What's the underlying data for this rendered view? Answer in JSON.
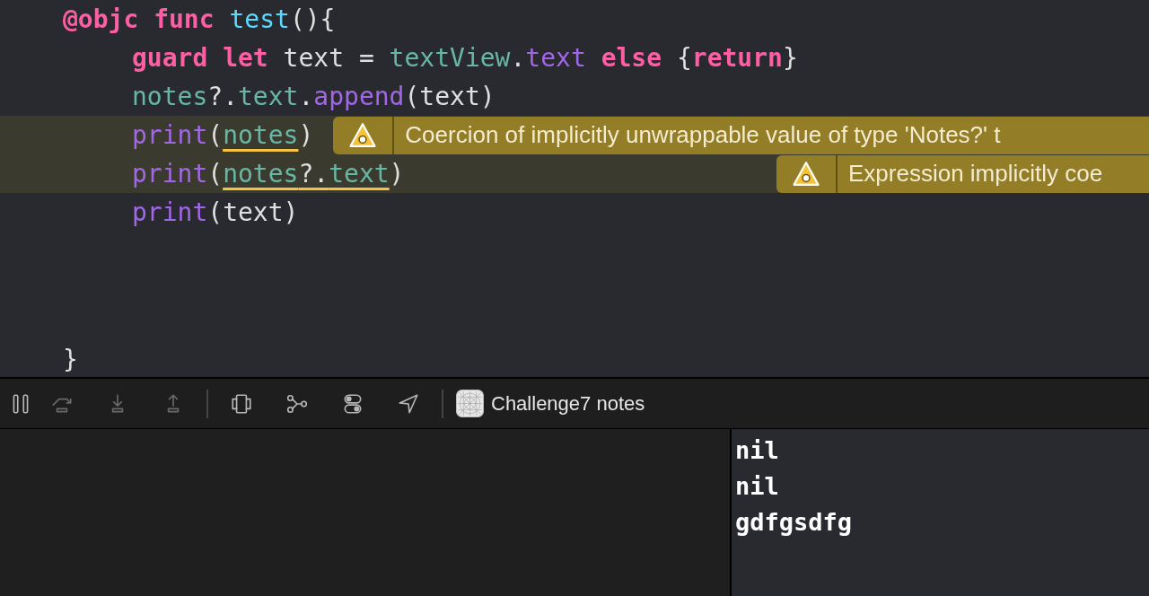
{
  "editor": {
    "lines": [
      {
        "tokens": [
          {
            "text": "@objc ",
            "kind": "keyword"
          },
          {
            "text": "func ",
            "kind": "keyword"
          },
          {
            "text": "test",
            "kind": "decl"
          },
          {
            "text": "(){",
            "kind": "plain"
          }
        ],
        "children": [
          {
            "tokens": [
              {
                "text": "guard ",
                "kind": "keyword"
              },
              {
                "text": "let ",
                "kind": "keyword"
              },
              {
                "text": "text = ",
                "kind": "plain"
              },
              {
                "text": "textView",
                "kind": "property"
              },
              {
                "text": ".",
                "kind": "plain"
              },
              {
                "text": "text ",
                "kind": "method"
              },
              {
                "text": "else ",
                "kind": "keyword"
              },
              {
                "text": "{",
                "kind": "plain"
              },
              {
                "text": "return",
                "kind": "keyword"
              },
              {
                "text": "}",
                "kind": "plain"
              }
            ]
          },
          {
            "tokens": [
              {
                "text": "notes",
                "kind": "property"
              },
              {
                "text": "?.",
                "kind": "plain"
              },
              {
                "text": "text",
                "kind": "property"
              },
              {
                "text": ".",
                "kind": "plain"
              },
              {
                "text": "append",
                "kind": "method"
              },
              {
                "text": "(text)",
                "kind": "plain"
              }
            ]
          },
          {
            "tokens": [
              {
                "text": "print",
                "kind": "method"
              },
              {
                "text": "(",
                "kind": "plain"
              },
              {
                "text": "notes",
                "kind": "property",
                "underlined": true
              },
              {
                "text": ")",
                "kind": "plain"
              }
            ],
            "warning": "Coercion of implicitly unwrappable value of type 'Notes?' t"
          },
          {
            "tokens": [
              {
                "text": "print",
                "kind": "method"
              },
              {
                "text": "(",
                "kind": "plain"
              },
              {
                "text": "notes",
                "kind": "property",
                "underlined": true
              },
              {
                "text": "?.",
                "kind": "plain",
                "underlined": true
              },
              {
                "text": "text",
                "kind": "property",
                "underlined": true
              },
              {
                "text": ")",
                "kind": "plain"
              }
            ],
            "warning": "Expression implicitly coe"
          },
          {
            "tokens": [
              {
                "text": "print",
                "kind": "method"
              },
              {
                "text": "(text)",
                "kind": "plain"
              }
            ]
          }
        ]
      },
      {
        "tokens": [
          {
            "text": "}",
            "kind": "plain"
          }
        ]
      }
    ]
  },
  "debug_bar": {
    "buttons": [
      {
        "kind": "pause",
        "disabled": false
      },
      {
        "kind": "step-over",
        "disabled": true
      },
      {
        "kind": "step-into",
        "disabled": true
      },
      {
        "kind": "step-out",
        "disabled": true
      },
      {
        "kind": "divider"
      },
      {
        "kind": "view-debugger",
        "disabled": false
      },
      {
        "kind": "memory-graph",
        "disabled": false
      },
      {
        "kind": "environment",
        "disabled": false
      },
      {
        "kind": "location",
        "disabled": false
      },
      {
        "kind": "divider"
      }
    ],
    "target": "Challenge7 notes"
  },
  "console": {
    "output": [
      "nil",
      "nil",
      "gdfgsdfg"
    ]
  }
}
